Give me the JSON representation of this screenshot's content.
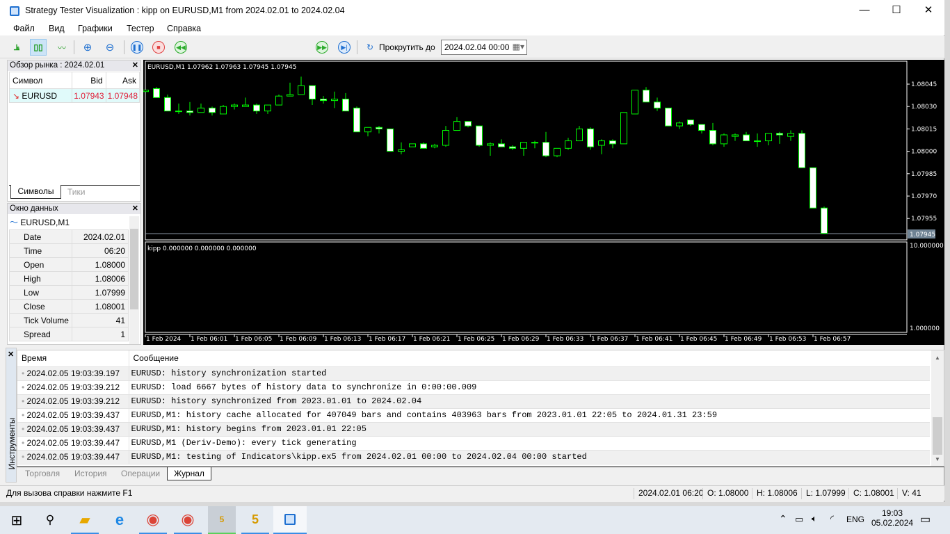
{
  "window": {
    "title": "Strategy Tester Visualization : kipp on EURUSD,M1 from 2024.02.01 to 2024.02.04",
    "minimize": "—",
    "maximize": "☐",
    "close": "✕"
  },
  "menu": [
    "Файл",
    "Вид",
    "Графики",
    "Тестер",
    "Справка"
  ],
  "toolbar": {
    "scroll_label": "Прокрутить до",
    "scroll_date": "2024.02.04 00:00",
    "speed_fraction": 0.74
  },
  "market_watch": {
    "title": "Обзор рынка : 2024.02.01",
    "columns": [
      "Символ",
      "Bid",
      "Ask"
    ],
    "rows": [
      {
        "symbol": "EURUSD",
        "bid": "1.07943",
        "ask": "1.07948"
      }
    ],
    "tabs": [
      "Символы",
      "Тики"
    ]
  },
  "data_window": {
    "title": "Окно данных",
    "symbol": "EURUSD,M1",
    "rows": [
      [
        "Date",
        "2024.02.01"
      ],
      [
        "Time",
        "06:20"
      ],
      [
        "Open",
        "1.08000"
      ],
      [
        "High",
        "1.08006"
      ],
      [
        "Low",
        "1.07999"
      ],
      [
        "Close",
        "1.08001"
      ],
      [
        "Tick Volume",
        "41"
      ],
      [
        "Spread",
        "1"
      ]
    ]
  },
  "chart_data": {
    "type": "candlestick",
    "header": "EURUSD,M1  1.07962 1.07963 1.07945 1.07945",
    "price_ticks": [
      "1.08045",
      "1.08030",
      "1.08015",
      "1.08000",
      "1.07985",
      "1.07970",
      "1.07955"
    ],
    "ylim": [
      1.07939,
      1.08058
    ],
    "current_price": "1.07945",
    "time_labels": [
      "1 Feb 2024",
      "1 Feb 06:01",
      "1 Feb 06:05",
      "1 Feb 06:09",
      "1 Feb 06:13",
      "1 Feb 06:17",
      "1 Feb 06:21",
      "1 Feb 06:25",
      "1 Feb 06:29",
      "1 Feb 06:33",
      "1 Feb 06:37",
      "1 Feb 06:41",
      "1 Feb 06:45",
      "1 Feb 06:49",
      "1 Feb 06:53",
      "1 Feb 06:57"
    ],
    "ohlc": [
      [
        1.0804,
        1.08041,
        1.0804,
        1.08041
      ],
      [
        1.08042,
        1.08043,
        1.08036,
        1.08036
      ],
      [
        1.08036,
        1.08038,
        1.08027,
        1.08027
      ],
      [
        1.08027,
        1.08032,
        1.08025,
        1.08027
      ],
      [
        1.08027,
        1.08033,
        1.08024,
        1.08026
      ],
      [
        1.08026,
        1.08032,
        1.08026,
        1.08029
      ],
      [
        1.08029,
        1.0803,
        1.08024,
        1.08026
      ],
      [
        1.08025,
        1.08031,
        1.08025,
        1.0803
      ],
      [
        1.0803,
        1.08032,
        1.08028,
        1.08031
      ],
      [
        1.0803,
        1.08036,
        1.0803,
        1.08031
      ],
      [
        1.08031,
        1.08032,
        1.08025,
        1.08027
      ],
      [
        1.08027,
        1.08031,
        1.08025,
        1.08031
      ],
      [
        1.08031,
        1.08038,
        1.08031,
        1.08037
      ],
      [
        1.08037,
        1.08046,
        1.08037,
        1.08038
      ],
      [
        1.08038,
        1.0805,
        1.08038,
        1.08044
      ],
      [
        1.08044,
        1.08044,
        1.08031,
        1.08035
      ],
      [
        1.08035,
        1.08037,
        1.08032,
        1.08034
      ],
      [
        1.08034,
        1.0804,
        1.08029,
        1.08035
      ],
      [
        1.08035,
        1.08039,
        1.08027,
        1.08027
      ],
      [
        1.08029,
        1.0803,
        1.08013,
        1.08013
      ],
      [
        1.08013,
        1.08016,
        1.0801,
        1.08016
      ],
      [
        1.08016,
        1.08017,
        1.08012,
        1.08015
      ],
      [
        1.08015,
        1.08015,
        1.08,
        1.08
      ],
      [
        1.08,
        1.08006,
        1.07998,
        1.08001
      ],
      [
        1.08003,
        1.08005,
        1.08003,
        1.08005
      ],
      [
        1.08005,
        1.08006,
        1.08002,
        1.08002
      ],
      [
        1.08003,
        1.08005,
        1.08002,
        1.08004
      ],
      [
        1.08004,
        1.08017,
        1.08003,
        1.08014
      ],
      [
        1.08014,
        1.08023,
        1.08014,
        1.0802
      ],
      [
        1.0802,
        1.0802,
        1.08016,
        1.08017
      ],
      [
        1.08017,
        1.08017,
        1.08003,
        1.08004
      ],
      [
        1.08004,
        1.08006,
        1.07997,
        1.08005
      ],
      [
        1.08005,
        1.08008,
        1.08003,
        1.08003
      ],
      [
        1.08003,
        1.08004,
        1.08001,
        1.08002
      ],
      [
        1.08002,
        1.08006,
        1.07997,
        1.08006
      ],
      [
        1.08006,
        1.08007,
        1.08002,
        1.08006
      ],
      [
        1.08006,
        1.08013,
        1.07996,
        1.07997
      ],
      [
        1.07997,
        1.08002,
        1.07996,
        1.08002
      ],
      [
        1.08002,
        1.08009,
        1.08001,
        1.08007
      ],
      [
        1.08007,
        1.08017,
        1.08007,
        1.08015
      ],
      [
        1.08015,
        1.08016,
        1.08001,
        1.08003
      ],
      [
        1.08004,
        1.08008,
        1.07998,
        1.08007
      ],
      [
        1.08007,
        1.08008,
        1.08002,
        1.08005
      ],
      [
        1.08005,
        1.08026,
        1.08005,
        1.08026
      ],
      [
        1.08025,
        1.08041,
        1.08025,
        1.08041
      ],
      [
        1.08041,
        1.08043,
        1.08033,
        1.08033
      ],
      [
        1.08033,
        1.08036,
        1.08027,
        1.08029
      ],
      [
        1.08029,
        1.08029,
        1.08017,
        1.08017
      ],
      [
        1.08017,
        1.0802,
        1.08015,
        1.08019
      ],
      [
        1.08021,
        1.08021,
        1.08017,
        1.08018
      ],
      [
        1.08018,
        1.08018,
        1.08012,
        1.08014
      ],
      [
        1.08014,
        1.08019,
        1.08004,
        1.08005
      ],
      [
        1.08005,
        1.08012,
        1.08003,
        1.08011
      ],
      [
        1.0801,
        1.08012,
        1.08007,
        1.08011
      ],
      [
        1.08011,
        1.08013,
        1.08007,
        1.08007
      ],
      [
        1.08007,
        1.08012,
        1.08003,
        1.08007
      ],
      [
        1.08007,
        1.08012,
        1.08004,
        1.08012
      ],
      [
        1.08012,
        1.08013,
        1.08005,
        1.08011
      ],
      [
        1.0801,
        1.08014,
        1.08007,
        1.08012
      ],
      [
        1.08012,
        1.08014,
        1.07989,
        1.07989
      ],
      [
        1.07989,
        1.07989,
        1.07962,
        1.07962
      ],
      [
        1.07962,
        1.07963,
        1.07945,
        1.07945
      ]
    ],
    "indicator": {
      "header": "kipp 0.000000 0.000000 0.000000",
      "ticks": [
        "10.000000",
        "1.000000"
      ]
    },
    "colors": {
      "bg": "#000000",
      "bull": "#00ff00",
      "bear_fill": "#ffffff"
    }
  },
  "journal": {
    "side_label": "Инструменты",
    "columns": [
      "Время",
      "Сообщение"
    ],
    "rows": [
      [
        "2024.02.05 19:03:39.197",
        "EURUSD: history synchronization started"
      ],
      [
        "2024.02.05 19:03:39.212",
        "EURUSD: load 6667 bytes of history data to synchronize in 0:00:00.009"
      ],
      [
        "2024.02.05 19:03:39.212",
        "EURUSD: history synchronized from 2023.01.01 to 2024.02.04"
      ],
      [
        "2024.02.05 19:03:39.437",
        "EURUSD,M1: history cache allocated for 407049 bars and contains 403963 bars from 2023.01.01 22:05 to 2024.01.31 23:59"
      ],
      [
        "2024.02.05 19:03:39.437",
        "EURUSD,M1: history begins from 2023.01.01 22:05"
      ],
      [
        "2024.02.05 19:03:39.447",
        "EURUSD,M1 (Deriv-Demo): every tick generating"
      ],
      [
        "2024.02.05 19:03:39.447",
        "EURUSD,M1: testing of Indicators\\kipp.ex5 from 2024.02.01 00:00 to 2024.02.04 00:00 started"
      ]
    ],
    "tabs": [
      "Торговля",
      "История",
      "Операции",
      "Журнал"
    ]
  },
  "status": {
    "help": "Для вызова справки нажмите F1",
    "datetime": "2024.02.01 06:20",
    "open": "O: 1.08000",
    "high": "H: 1.08006",
    "low": "L: 1.07999",
    "close": "C: 1.08001",
    "volume": "V: 41"
  },
  "taskbar": {
    "lang": "ENG",
    "time": "19:03",
    "date": "05.02.2024"
  }
}
